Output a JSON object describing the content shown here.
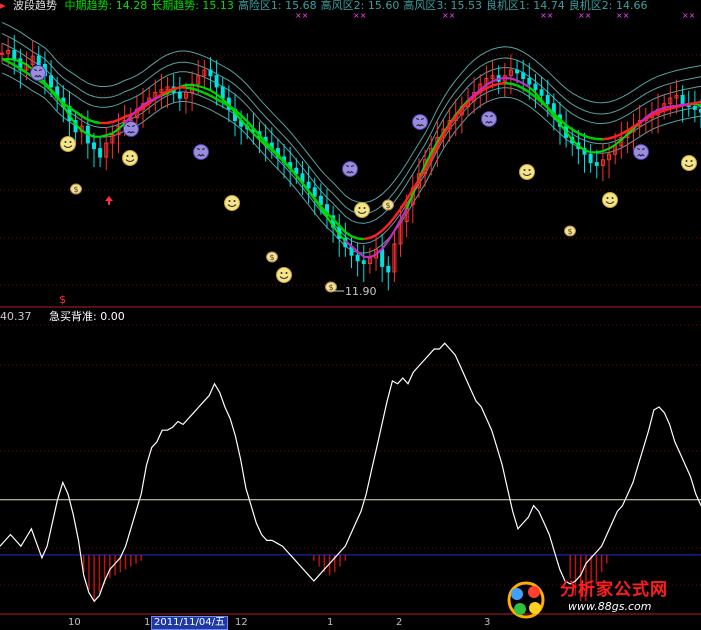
{
  "header": {
    "title": "波段趋势",
    "items": [
      {
        "label": "中期趋势",
        "value": "14.28",
        "color": "#00e000"
      },
      {
        "label": "长期趋势",
        "value": "15.13",
        "color": "#00e000"
      },
      {
        "label": "高险区1",
        "value": "15.68",
        "color": "#3aa0a0"
      },
      {
        "label": "高风区2",
        "value": "15.60",
        "color": "#3aa0a0"
      },
      {
        "label": "高风区3",
        "value": "15.53",
        "color": "#3aa0a0"
      },
      {
        "label": "良机区1",
        "value": "14.74",
        "color": "#3aa0a0"
      },
      {
        "label": "良机区2",
        "value": "14.66",
        "color": "#3aa0a0"
      }
    ]
  },
  "upper_panel": {
    "low_label": "11.90",
    "dollar_mark": "$"
  },
  "lower_panel": {
    "left_value": "40.37",
    "indicator_label": "急买背准",
    "indicator_value": "0.00"
  },
  "x_axis": {
    "labels": [
      "10",
      "11",
      "12",
      "1",
      "2",
      "3"
    ],
    "selected_date": "2011/11/04/五"
  },
  "watermark": {
    "name": "分析家公式网",
    "url": "www.88gs.com"
  },
  "colors": {
    "background": "#000000",
    "up_candle": "#ff3030",
    "down_candle": "#00e0e0",
    "mid_trend": "#00e000",
    "long_trend_up": "#ff2020",
    "long_trend_down": "#00d000",
    "turn": "#d020d0",
    "band": "#5aa0a0",
    "oscillator": "#ffffff",
    "hist": "#c01010",
    "guide": "#e8e0b0",
    "blue_guide": "#1f2fd0"
  },
  "chart_data": [
    {
      "type": "candlestick",
      "title": "波段趋势",
      "ylim": [
        11.5,
        16.6
      ],
      "note_low": 11.9,
      "closes": [
        15.9,
        15.95,
        15.8,
        15.6,
        15.7,
        15.85,
        15.7,
        15.5,
        15.3,
        15.1,
        14.95,
        14.7,
        14.5,
        14.6,
        14.3,
        14.2,
        14.05,
        14.3,
        14.45,
        14.6,
        14.7,
        14.75,
        14.9,
        15.0,
        15.1,
        15.2,
        15.25,
        15.3,
        15.2,
        15.1,
        15.2,
        15.35,
        15.5,
        15.6,
        15.5,
        15.3,
        15.1,
        14.9,
        14.7,
        14.6,
        14.55,
        14.5,
        14.4,
        14.3,
        14.2,
        14.05,
        13.95,
        13.85,
        13.75,
        13.6,
        13.5,
        13.35,
        13.2,
        13.0,
        12.8,
        12.6,
        12.45,
        12.3,
        12.2,
        12.15,
        12.25,
        12.4,
        12.1,
        12.0,
        12.5,
        12.9,
        13.2,
        13.5,
        13.75,
        14.0,
        14.2,
        14.4,
        14.55,
        14.7,
        14.8,
        14.95,
        15.05,
        15.2,
        15.35,
        15.45,
        15.5,
        15.4,
        15.5,
        15.6,
        15.55,
        15.45,
        15.35,
        15.25,
        15.15,
        15.0,
        14.8,
        14.6,
        14.4,
        14.3,
        14.2,
        14.1,
        13.95,
        13.9,
        14.0,
        14.1,
        14.25,
        14.4,
        14.5,
        14.6,
        14.7,
        14.75,
        14.8,
        14.9,
        15.0,
        15.1,
        15.15,
        15.0,
        14.95,
        14.9,
        14.85
      ]
    },
    {
      "type": "line",
      "title": "急买背准",
      "ylim": [
        0,
        100
      ],
      "threshold_upper": 38,
      "threshold_lower": 19,
      "values": [
        22,
        24,
        26,
        24,
        22,
        25,
        28,
        23,
        18,
        22,
        30,
        38,
        44,
        40,
        33,
        24,
        12,
        6,
        3,
        5,
        10,
        14,
        16,
        18,
        22,
        28,
        34,
        40,
        50,
        56,
        58,
        62,
        62,
        63,
        65,
        64,
        66,
        68,
        70,
        72,
        74,
        78,
        75,
        70,
        66,
        60,
        52,
        42,
        36,
        30,
        26,
        24,
        24,
        23,
        22,
        20,
        18,
        16,
        14,
        12,
        10,
        12,
        14,
        16,
        18,
        20,
        22,
        26,
        30,
        34,
        40,
        48,
        56,
        64,
        72,
        79,
        78,
        80,
        78,
        82,
        84,
        86,
        88,
        90,
        90,
        92,
        90,
        88,
        84,
        80,
        76,
        72,
        70,
        66,
        62,
        56,
        50,
        42,
        34,
        28,
        30,
        32,
        36,
        34,
        30,
        26,
        20,
        14,
        10,
        9,
        10,
        12,
        16,
        18,
        20,
        22,
        26,
        30,
        34,
        36,
        40,
        44,
        50,
        56,
        62,
        69,
        70,
        68,
        64,
        58,
        54,
        50,
        46,
        40,
        36
      ]
    },
    {
      "type": "bar",
      "title": "hist",
      "values": [
        0,
        0,
        0,
        0,
        0,
        0,
        0,
        0,
        0,
        0,
        0,
        0,
        0,
        0,
        0,
        0,
        -6,
        -12,
        -16,
        -13,
        -10,
        -8,
        -7,
        -6,
        -5,
        -4,
        -3,
        -2,
        0,
        0,
        0,
        0,
        0,
        0,
        0,
        0,
        0,
        0,
        0,
        0,
        0,
        0,
        0,
        0,
        0,
        0,
        0,
        0,
        0,
        0,
        0,
        0,
        0,
        0,
        0,
        0,
        0,
        0,
        0,
        0,
        -2,
        -4,
        -6,
        -7,
        -6,
        -4,
        -2,
        0,
        0,
        0,
        0,
        0,
        0,
        0,
        0,
        0,
        0,
        0,
        0,
        0,
        0,
        0,
        0,
        0,
        0,
        0,
        0,
        0,
        0,
        0,
        0,
        0,
        0,
        0,
        0,
        0,
        0,
        0,
        0,
        0,
        0,
        0,
        0,
        0,
        0,
        0,
        0,
        0,
        0,
        -8,
        -14,
        -16,
        -16,
        -14,
        -10,
        -6,
        -3,
        0,
        0,
        0,
        0,
        0,
        0,
        0,
        0,
        0,
        0,
        0,
        0,
        0,
        0,
        0,
        0,
        0,
        0
      ]
    }
  ]
}
